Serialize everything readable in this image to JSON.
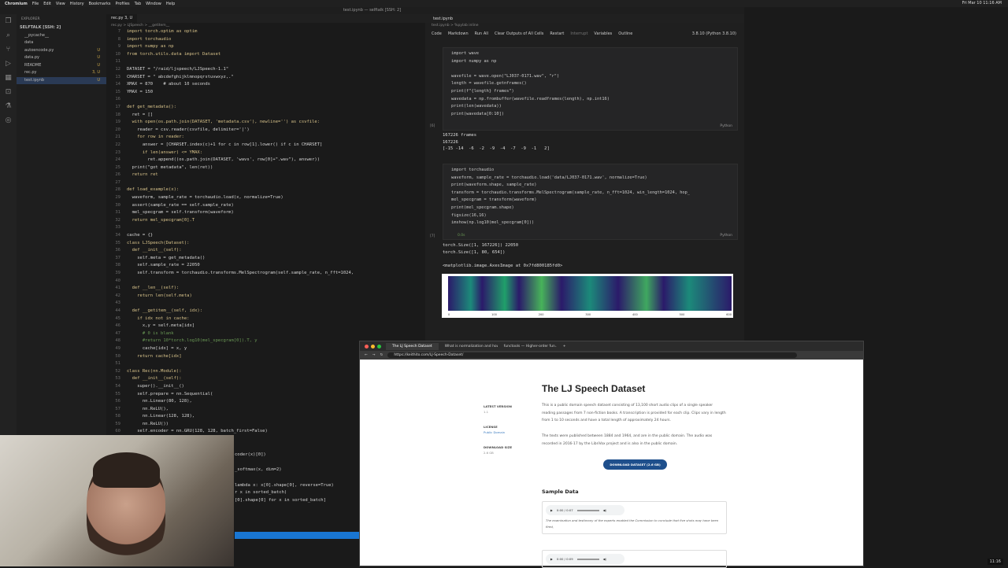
{
  "menubar": {
    "items": [
      "Chromium",
      "File",
      "Edit",
      "View",
      "History",
      "Bookmarks",
      "Profiles",
      "Tab",
      "Window",
      "Help"
    ],
    "clock": "Fri Mar 10 11:16 AM"
  },
  "window_title": "test.ipynb — selftalk [SSH: 2]",
  "explorer": {
    "header": "EXPLORER",
    "root": "SELFTALK [SSH: 2]",
    "files": [
      {
        "name": "__pycache__",
        "badge": ""
      },
      {
        "name": "data",
        "badge": ""
      },
      {
        "name": "autoencode.py",
        "badge": "U"
      },
      {
        "name": "data.py",
        "badge": "U"
      },
      {
        "name": "README",
        "badge": "U"
      },
      {
        "name": "rec.py",
        "badge": "3, U"
      },
      {
        "name": "test.ipynb",
        "badge": "U"
      }
    ]
  },
  "editor": {
    "tab": "rec.py 3, U",
    "breadcrumb": "rec.py > LJSpeech > __getitem__",
    "lines": [
      {
        "n": "7",
        "t": "import torch.optim as optim"
      },
      {
        "n": "8",
        "t": "import torchaudio"
      },
      {
        "n": "9",
        "t": "import numpy as np"
      },
      {
        "n": "10",
        "t": "from torch.utils.data import Dataset"
      },
      {
        "n": "11",
        "t": ""
      },
      {
        "n": "12",
        "t": "DATASET = \"/raid/ljspeech/LJSpeech-1.1\""
      },
      {
        "n": "13",
        "t": "CHARSET = \" abcdefghijklmnopqrstuvwxyz,.\""
      },
      {
        "n": "14",
        "t": "XMAX = 870    # about 10 seconds"
      },
      {
        "n": "15",
        "t": "YMAX = 150"
      },
      {
        "n": "16",
        "t": ""
      },
      {
        "n": "17",
        "t": "def get_metadata():"
      },
      {
        "n": "18",
        "t": "  ret = []"
      },
      {
        "n": "19",
        "t": "  with open(os.path.join(DATASET, 'metadata.csv'), newline='') as csvfile:"
      },
      {
        "n": "20",
        "t": "    reader = csv.reader(csvfile, delimiter='|')"
      },
      {
        "n": "21",
        "t": "    for row in reader:"
      },
      {
        "n": "22",
        "t": "      answer = [CHARSET.index(c)+1 for c in row[1].lower() if c in CHARSET]"
      },
      {
        "n": "23",
        "t": "      if len(answer) <= YMAX:"
      },
      {
        "n": "24",
        "t": "        ret.append((os.path.join(DATASET, 'wavs', row[0]+\".wav\"), answer))"
      },
      {
        "n": "25",
        "t": "  print(\"got metadata\", len(ret))"
      },
      {
        "n": "26",
        "t": "  return ret"
      },
      {
        "n": "27",
        "t": ""
      },
      {
        "n": "28",
        "t": "def load_example(x):"
      },
      {
        "n": "29",
        "t": "  waveform, sample_rate = torchaudio.load(x, normalize=True)"
      },
      {
        "n": "30",
        "t": "  assert(sample_rate == self.sample_rate)"
      },
      {
        "n": "31",
        "t": "  mel_specgram = self.transform(waveform)"
      },
      {
        "n": "32",
        "t": "  return mel_specgram[0].T"
      },
      {
        "n": "33",
        "t": ""
      },
      {
        "n": "34",
        "t": "cache = {}"
      },
      {
        "n": "35",
        "t": "class LJSpeech(Dataset):"
      },
      {
        "n": "36",
        "t": "  def __init__(self):"
      },
      {
        "n": "37",
        "t": "    self.meta = get_metadata()"
      },
      {
        "n": "38",
        "t": "    self.sample_rate = 22050"
      },
      {
        "n": "39",
        "t": "    self.transform = torchaudio.transforms.MelSpectrogram(self.sample_rate, n_fft=1024,"
      },
      {
        "n": "40",
        "t": ""
      },
      {
        "n": "41",
        "t": "  def __len__(self):"
      },
      {
        "n": "42",
        "t": "    return len(self.meta)"
      },
      {
        "n": "43",
        "t": ""
      },
      {
        "n": "44",
        "t": "  def __getitem__(self, idx):"
      },
      {
        "n": "45",
        "t": "    if idx not in cache:"
      },
      {
        "n": "46",
        "t": "      x,y = self.meta[idx]"
      },
      {
        "n": "47",
        "t": "      # 0 is blank"
      },
      {
        "n": "48",
        "t": "      #return 10*torch.log10(mel_specgram[0]).T, y"
      },
      {
        "n": "49",
        "t": "      cache[idx] = x, y"
      },
      {
        "n": "50",
        "t": "    return cache[idx]"
      },
      {
        "n": "51",
        "t": ""
      },
      {
        "n": "52",
        "t": "class Rec(nn.Module):"
      },
      {
        "n": "53",
        "t": "  def __init__(self):"
      },
      {
        "n": "54",
        "t": "    super().__init__()"
      },
      {
        "n": "55",
        "t": "    self.prepare = nn.Sequential("
      },
      {
        "n": "56",
        "t": "      nn.Linear(80, 128),"
      },
      {
        "n": "57",
        "t": "      nn.ReLU(),"
      },
      {
        "n": "58",
        "t": "      nn.Linear(128, 128),"
      },
      {
        "n": "59",
        "t": "      nn.ReLU())"
      },
      {
        "n": "60",
        "t": "    self.encoder = nn.GRU(128, 128, batch_first=False)"
      },
      {
        "n": "61",
        "t": "                            en(CHARSET)"
      }
    ],
    "peek_lines": [
      "",
      "",
      "coder(x)[0])",
      "",
      "_softmax(x, dim=2)",
      "",
      "lambda x: x[0].shape[0], reverse=True)",
      "r x in sorted_batch)",
      "[0].shape[0] for x in sorted_batch]"
    ]
  },
  "notebook": {
    "tab": "test.ipynb",
    "breadcrumb": "test.ipynb > %pylab inline",
    "toolbar": [
      "Code",
      "Markdown",
      "Run All",
      "Clear Outputs of All Cells",
      "Restart",
      "Interrupt",
      "Variables",
      "Outline"
    ],
    "kernel": "3.8.10 (Python 3.8.10)",
    "cell1": {
      "idx": "[6]",
      "code": "import wave\nimport numpy as np\n\nwavefile = wave.open(\"LJ037-0171.wav\", \"r\")\nlength = wavefile.getnframes()\nprint(f\"{length} frames\")\nwavedata = np.frombuffer(wavefile.readframes(length), np.int16)\nprint(len(wavedata))\nprint(wavedata[0:10])",
      "lang": "Python",
      "output": "167226 frames\n167226\n[-15 -14  -6  -2  -9  -4  -7  -9  -1   2]"
    },
    "cell2": {
      "idx": "[7]",
      "code": "import torchaudio\nwaveform, sample_rate = torchaudio.load('data/LJ037-0171.wav', normalize=True)\nprint(waveform.shape, sample_rate)\ntransform = torchaudio.transforms.MelSpectrogram(sample_rate, n_fft=1024, win_length=1024, hop_\nmel_specgram = transform(waveform)\nprint(mel_specgram.shape)\nfigsize(16,16)\nimshow(np.log10(mel_specgram[0]))",
      "time": "0.0s",
      "lang": "Python",
      "output": "torch.Size([1, 167226]) 22050\ntorch.Size([1, 80, 654])\n\n<matplotlib.image.AxesImage at 0x7fd800185fd0>"
    },
    "plot_ticks": [
      "0",
      "100",
      "200",
      "300",
      "400",
      "500",
      "600"
    ]
  },
  "browser": {
    "tabs": [
      "The LJ Speech Dataset",
      "What is normalization and how...",
      "functools — Higher-order fun..."
    ],
    "url": "https://keithito.com/LJ-Speech-Dataset/",
    "page": {
      "title": "The LJ Speech Dataset",
      "meta": [
        {
          "label": "LATEST VERSION",
          "value": "1.1"
        },
        {
          "label": "LICENSE",
          "value": "Public Domain"
        },
        {
          "label": "DOWNLOAD SIZE",
          "value": "2.6 GB"
        }
      ],
      "para1": "This is a public domain speech dataset consisting of 13,100 short audio clips of a single speaker reading passages from 7 non-fiction books. A transcription is provided for each clip. Clips vary in length from 1 to 10 seconds and have a total length of approximately 24 hours.",
      "para2": "The texts were published between 1884 and 1964, and are in the public domain. The audio was recorded in 2016-17 by the LibriVox project and is also in the public domain.",
      "download": "DOWNLOAD DATASET (2.6 GB)",
      "sample_heading": "Sample Data",
      "sample1": {
        "time": "0:00 / 0:07",
        "caption": "The examination and testimony of the experts enabled the Commission to conclude that five shots may have been fired,"
      },
      "sample2": {
        "time": "0:00 / 0:09"
      }
    }
  },
  "taskbar_clock": "11:16"
}
